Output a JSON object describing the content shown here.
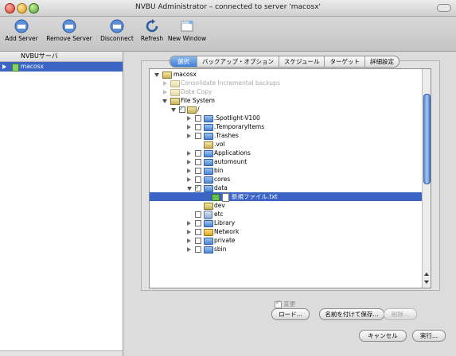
{
  "window": {
    "title": "NVBU Administrator – connected to server 'macosx'"
  },
  "toolbar": {
    "buttons": [
      {
        "label": "Add Server",
        "icon": "add-server-icon"
      },
      {
        "label": "Remove Server",
        "icon": "remove-server-icon"
      },
      {
        "label": "Disconnect",
        "icon": "disconnect-icon"
      },
      {
        "label": "Refresh",
        "icon": "refresh-icon"
      },
      {
        "label": "New Window",
        "icon": "new-window-icon"
      }
    ]
  },
  "sidebar": {
    "header": "NVBUサーバ",
    "items": [
      {
        "label": "macosx",
        "selected": true
      }
    ]
  },
  "tabs": [
    {
      "label": "選択",
      "selected": true
    },
    {
      "label": "バックアップ・オプション"
    },
    {
      "label": "スケジュール"
    },
    {
      "label": "ターゲット"
    },
    {
      "label": "詳細設定"
    }
  ],
  "tree": {
    "rows": [
      {
        "label": "macosx"
      },
      {
        "label": "Consolidate Incremental backups"
      },
      {
        "label": "Data Copy"
      },
      {
        "label": "File System"
      },
      {
        "label": "/"
      },
      {
        "label": ".Spotlight-V100"
      },
      {
        "label": ".TemporaryItems"
      },
      {
        "label": ".Trashes"
      },
      {
        "label": ".vol"
      },
      {
        "label": "Applications"
      },
      {
        "label": "automount"
      },
      {
        "label": "bin"
      },
      {
        "label": "cores"
      },
      {
        "label": "data"
      },
      {
        "label": "新規ファイル.txt"
      },
      {
        "label": "dev"
      },
      {
        "label": "etc"
      },
      {
        "label": "Library"
      },
      {
        "label": "Network"
      },
      {
        "label": "private"
      },
      {
        "label": "sbin"
      }
    ]
  },
  "options": {
    "changed_label": "変更"
  },
  "buttons": {
    "load": "ロード...",
    "save_as": "名前を付けて保存...",
    "delete": "削除...",
    "cancel": "キャンセル",
    "execute": "実行..."
  },
  "colors": {
    "selection": "#3b64c4",
    "tab_selected": "#3f7fd6"
  }
}
